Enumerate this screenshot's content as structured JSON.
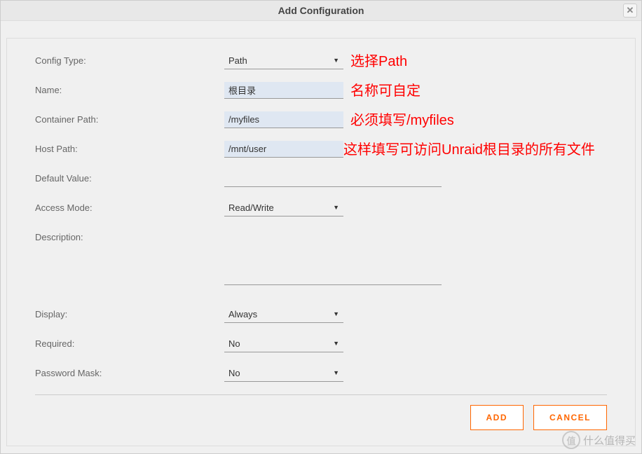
{
  "dialog": {
    "title": "Add Configuration",
    "close_label": "✕"
  },
  "form": {
    "config_type": {
      "label": "Config Type:",
      "value": "Path"
    },
    "name": {
      "label": "Name:",
      "value": "根目录"
    },
    "container_path": {
      "label": "Container Path:",
      "value": "/myfiles"
    },
    "host_path": {
      "label": "Host Path:",
      "value": "/mnt/user"
    },
    "default_value": {
      "label": "Default Value:",
      "value": ""
    },
    "access_mode": {
      "label": "Access Mode:",
      "value": "Read/Write"
    },
    "description": {
      "label": "Description:",
      "value": ""
    },
    "display": {
      "label": "Display:",
      "value": "Always"
    },
    "required": {
      "label": "Required:",
      "value": "No"
    },
    "password_mask": {
      "label": "Password Mask:",
      "value": "No"
    }
  },
  "annotations": {
    "config_type": "选择Path",
    "name": "名称可自定",
    "container_path": "必须填写/myfiles",
    "host_path": "这样填写可访问Unraid根目录的所有文件"
  },
  "footer": {
    "add": "ADD",
    "cancel": "CANCEL"
  },
  "watermark": {
    "icon": "值",
    "text": "什么值得买"
  }
}
